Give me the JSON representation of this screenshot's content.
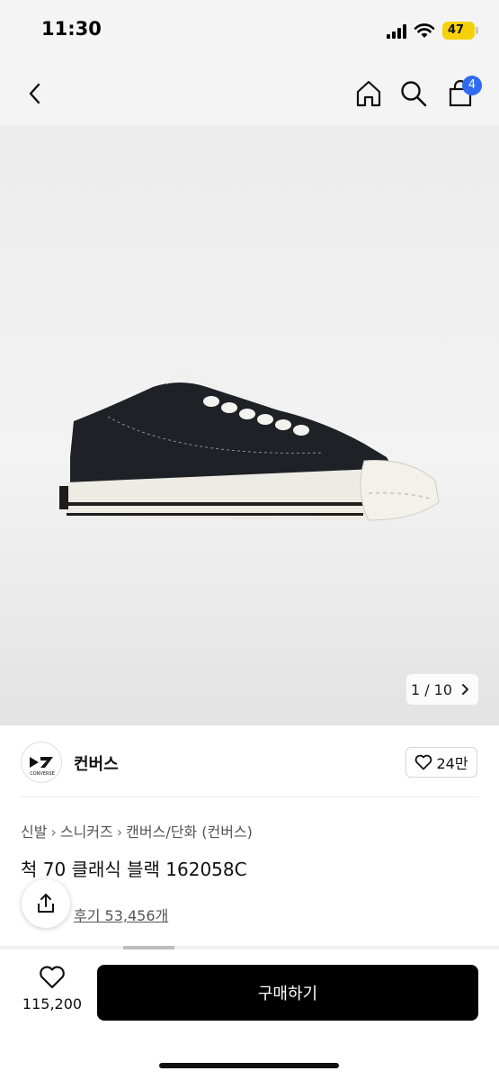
{
  "status_bar": {
    "time": "11:30",
    "battery": "47"
  },
  "nav": {
    "cart_count": "4"
  },
  "gallery": {
    "counter": "1 / 10"
  },
  "brand": {
    "name": "컨버스",
    "logo_text": "CONVERSE",
    "likes": "24만"
  },
  "breadcrumb": [
    "신발",
    "스니커즈",
    "캔버스/단화 (컨버스)"
  ],
  "product": {
    "title": "척 70 클래식 블랙 162058C",
    "review_text": "후기 53,456개"
  },
  "bottom": {
    "wish_count": "115,200",
    "buy_label": "구매하기"
  },
  "colors": {
    "accent_badge": "#2f6bf2",
    "buy_button": "#000000",
    "battery": "#f5d10b"
  }
}
